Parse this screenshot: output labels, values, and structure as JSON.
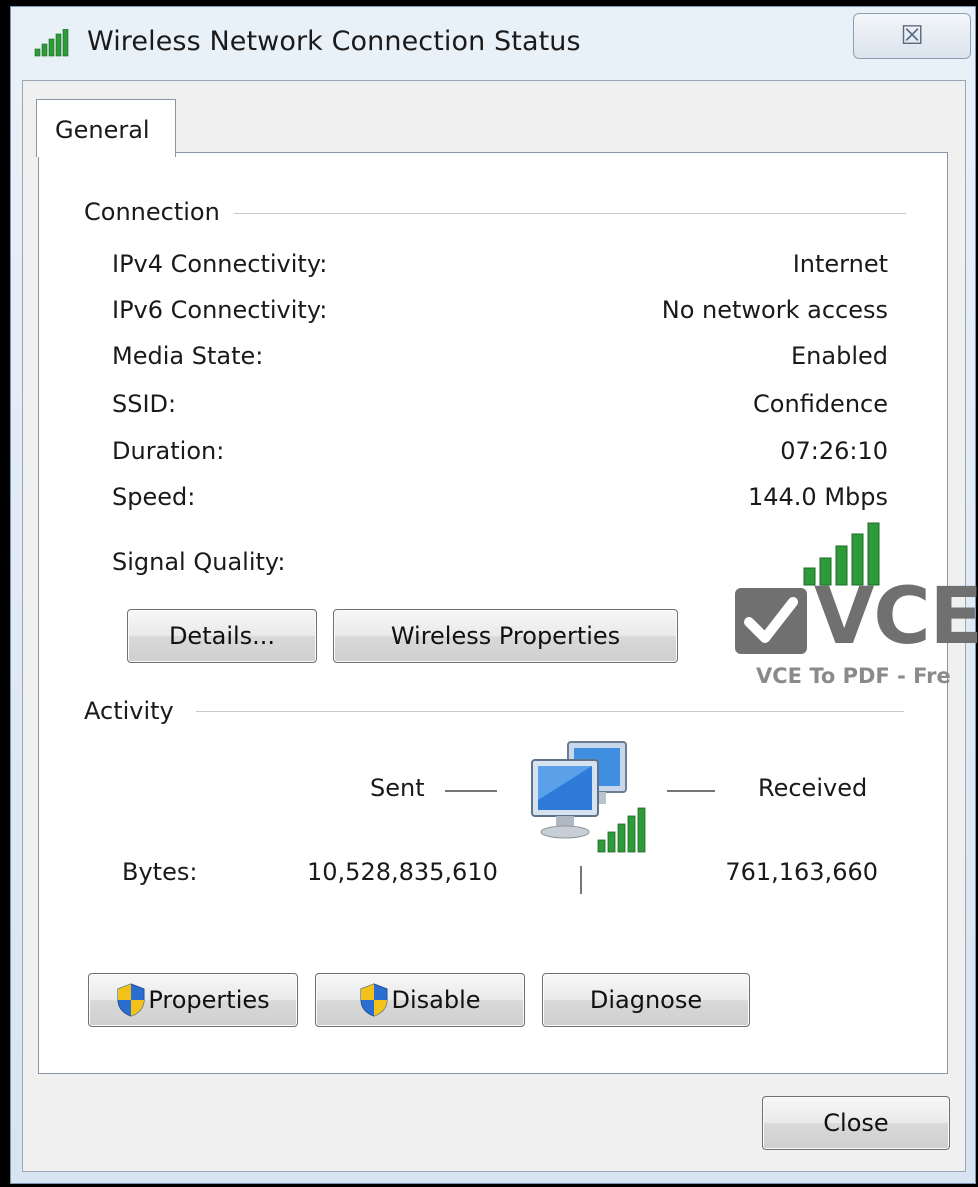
{
  "window": {
    "title": "Wireless Network Connection Status",
    "close_glyph": "☒"
  },
  "tabs": [
    {
      "label": "General",
      "selected": true
    }
  ],
  "connection": {
    "heading": "Connection",
    "rows": [
      {
        "label": "IPv4 Connectivity:",
        "value": "Internet"
      },
      {
        "label": "IPv6 Connectivity:",
        "value": "No network access"
      },
      {
        "label": "Media State:",
        "value": "Enabled"
      },
      {
        "label": "SSID:",
        "value": "Confidence"
      },
      {
        "label": "Duration:",
        "value": "07:26:10"
      },
      {
        "label": "Speed:",
        "value": "144.0 Mbps"
      }
    ],
    "signal_quality_label": "Signal Quality:",
    "signal_bars_lit": 5,
    "signal_bars_total": 5
  },
  "buttons": {
    "details": "Details...",
    "wireless_properties": "Wireless Properties",
    "properties": "Properties",
    "disable": "Disable",
    "diagnose": "Diagnose",
    "close": "Close"
  },
  "activity": {
    "heading": "Activity",
    "sent_label": "Sent",
    "received_label": "Received",
    "bytes_label": "Bytes:",
    "bytes_sent": "10,528,835,610",
    "bytes_received": "761,163,660"
  },
  "watermark": {
    "logo_text": "VCE",
    "subtitle": "VCE To PDF - Fre"
  },
  "colors": {
    "signal_green": "#2e9a3a",
    "shield_blue": "#2a6fd0",
    "shield_yellow": "#f2c21a",
    "watermark_gray": "#707070"
  }
}
